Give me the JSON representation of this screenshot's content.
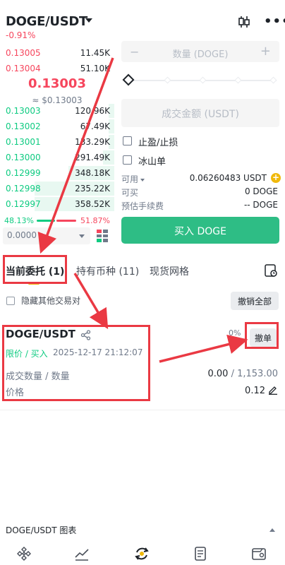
{
  "header": {
    "pair": "DOGE/USDT",
    "change": "-0.91%",
    "icons": {
      "chart": "candlestick-icon",
      "more": "more-icon"
    }
  },
  "orderbook": {
    "asks": [
      {
        "price": "0.13005",
        "qty": "11.45K",
        "depth": 0
      },
      {
        "price": "0.13004",
        "qty": "51.10K",
        "depth": 0
      }
    ],
    "last_price": "0.13003",
    "last_usd": "≈ $0.13003",
    "bids": [
      {
        "price": "0.13003",
        "qty": "120.96K",
        "depth": 0.05
      },
      {
        "price": "0.13002",
        "qty": "67.49K",
        "depth": 0.05
      },
      {
        "price": "0.13001",
        "qty": "133.29K",
        "depth": 0.05
      },
      {
        "price": "0.13000",
        "qty": "291.49K",
        "depth": 0.1
      },
      {
        "price": "0.12999",
        "qty": "348.18K",
        "depth": 0.4
      },
      {
        "price": "0.12998",
        "qty": "235.22K",
        "depth": 0.7
      },
      {
        "price": "0.12997",
        "qty": "358.52K",
        "depth": 0.7
      }
    ],
    "buy_ratio": "48.13%",
    "sell_ratio": "51.87%",
    "depth_value": "0.0000"
  },
  "form": {
    "qty_placeholder": "数量 (DOGE)",
    "qty_minus": "−",
    "qty_plus": "+",
    "total_placeholder": "成交金额 (USDT)",
    "tpsl_label": "止盈/止损",
    "iceberg_label": "冰山单",
    "available_label": "可用",
    "available_value": "0.06260483 USDT",
    "can_buy_label": "可买",
    "can_buy_value": "0 DOGE",
    "fee_label": "预估手续费",
    "fee_value": "-- DOGE",
    "buy_button": "买入 DOGE"
  },
  "tabs": {
    "open_orders": "当前委托 (1)",
    "holdings": "持有币种 (11)",
    "grid": "现货网格"
  },
  "filter": {
    "hide_other_pairs": "隐藏其他交易对",
    "cancel_all": "撤销全部"
  },
  "order": {
    "symbol": "DOGE/USDT",
    "fill_pct": "0%",
    "cancel": "撤单",
    "type": "限价 / 买入",
    "time": "2025-12-17 21:12:07",
    "filled_label": "成交数量 / 数量",
    "filled_value": "0.00",
    "total_value": " / 1,153.00",
    "price_label": "价格",
    "price_value": "0.12"
  },
  "chart_bar": {
    "label": "DOGE/USDT 图表"
  },
  "colors": {
    "accent_yellow": "#f0b90b",
    "buy_green": "#2ebd85",
    "sell_red": "#f6465d",
    "annotation_red": "#ea3943"
  }
}
